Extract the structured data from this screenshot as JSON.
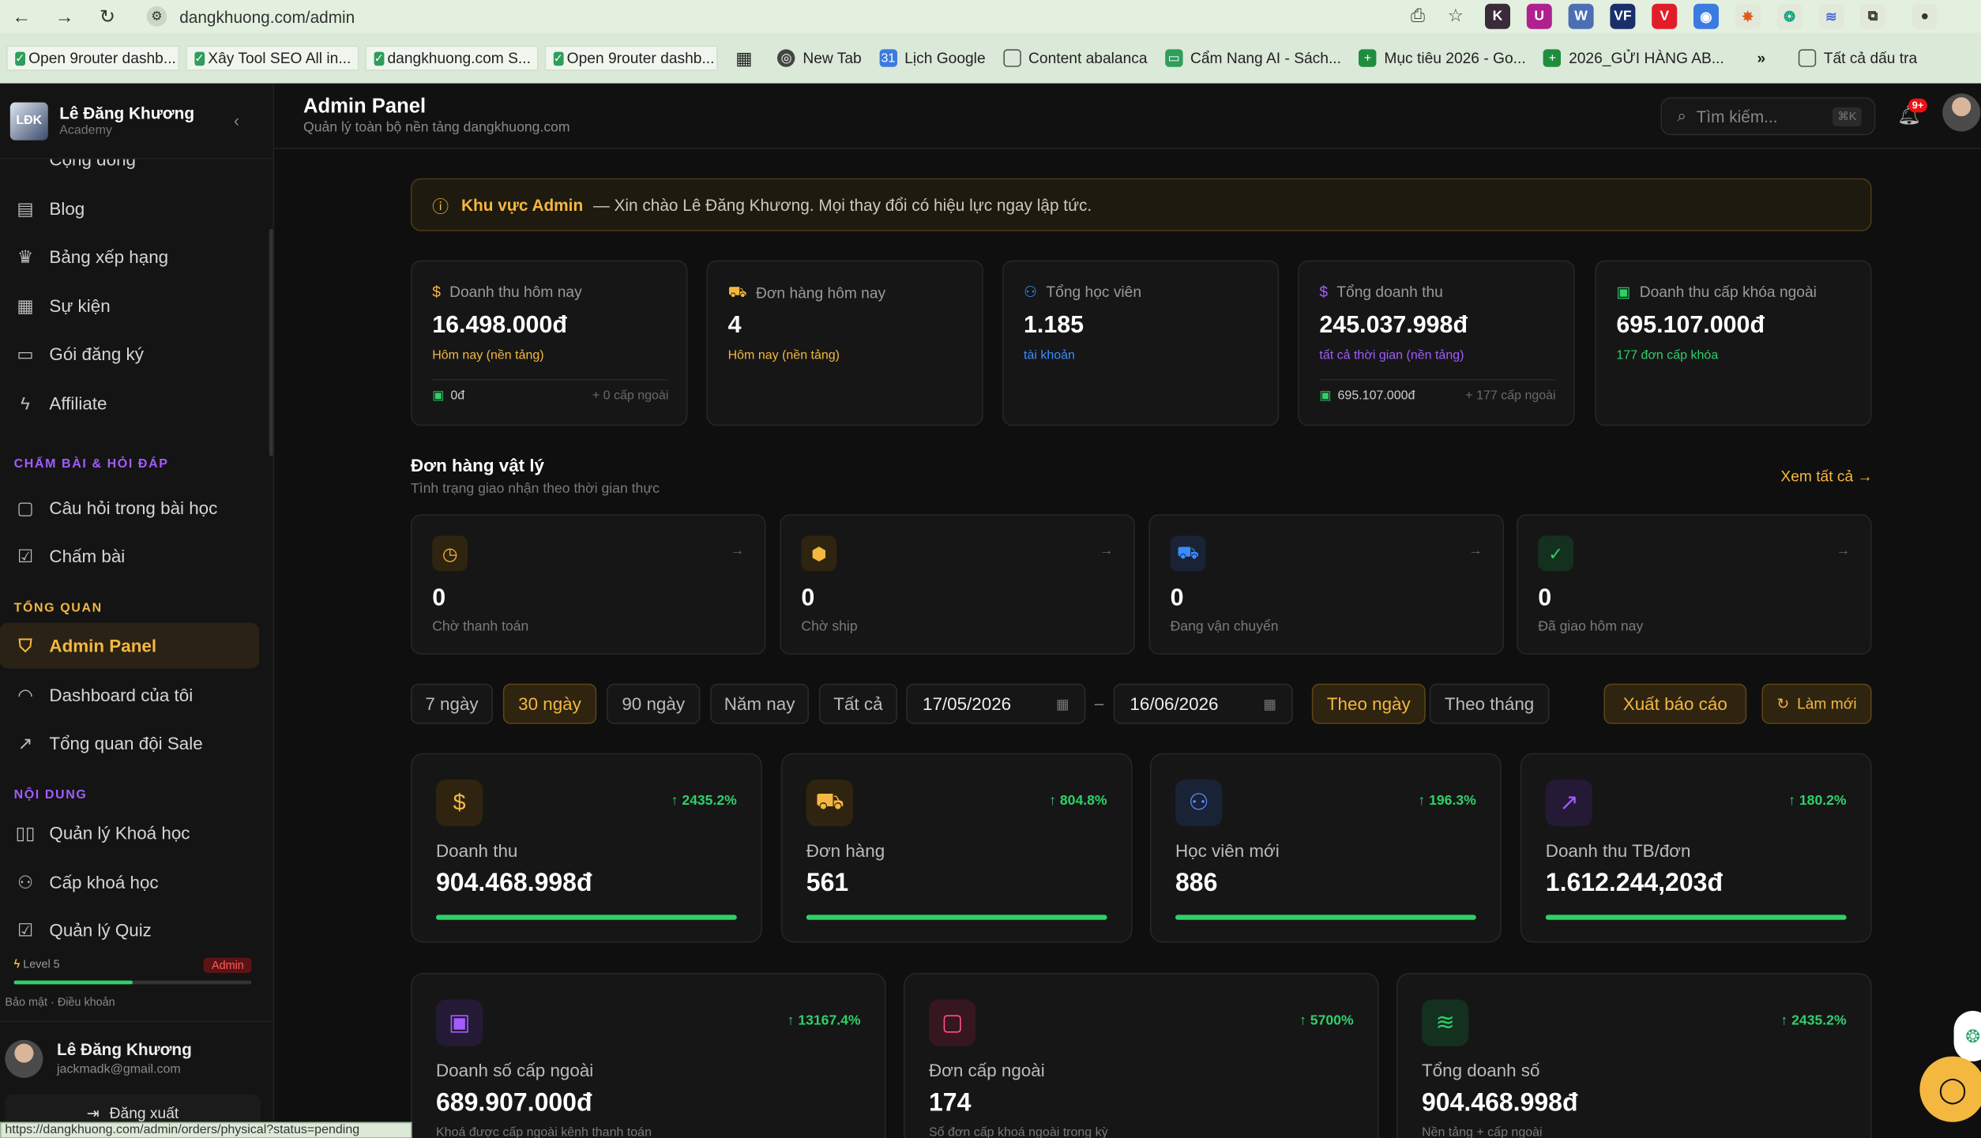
{
  "browser": {
    "url": "dangkhuong.com/admin",
    "status_url": "https://dangkhuong.com/admin/orders/physical?status=pending",
    "tabs": [
      "Open 9router dashb...",
      "Xây Tool SEO All in...",
      "dangkhuong.com S...",
      "Open 9router dashb..."
    ],
    "bookmarks": [
      "New Tab",
      "Lịch Google",
      "Content abalanca",
      "Cẩm Nang AI - Sách...",
      "Mục tiêu 2026 - Go...",
      "2026_GỬI HÀNG AB..."
    ],
    "all_bookmarks": "Tất cả dấu tra"
  },
  "sidebar": {
    "brand_name": "Lê Đăng Khương",
    "brand_sub": "Academy",
    "items": [
      {
        "label": "Cộng đồng",
        "icon": "community-icon"
      },
      {
        "label": "Blog",
        "icon": "blog-icon"
      },
      {
        "label": "Bảng xếp hạng",
        "icon": "trophy-icon"
      },
      {
        "label": "Sự kiện",
        "icon": "calendar-icon"
      },
      {
        "label": "Gói đăng ký",
        "icon": "card-icon"
      },
      {
        "label": "Affiliate",
        "icon": "bolt-icon"
      }
    ],
    "section_grading": "CHẤM BÀI & HỎI ĐÁP",
    "grading_items": [
      {
        "label": "Câu hỏi trong bài học",
        "icon": "chat-bubble-icon"
      },
      {
        "label": "Chấm bài",
        "icon": "clipboard-check-icon"
      }
    ],
    "section_overview": "TỔNG QUAN",
    "overview_items": [
      {
        "label": "Admin Panel",
        "icon": "shield-check-icon",
        "active": true
      },
      {
        "label": "Dashboard của tôi",
        "icon": "gauge-icon"
      },
      {
        "label": "Tổng quan đội Sale",
        "icon": "trend-icon"
      }
    ],
    "section_content": "NỘI DUNG",
    "content_items": [
      {
        "label": "Quản lý Khoá học",
        "icon": "book-icon"
      },
      {
        "label": "Cấp khoá học",
        "icon": "user-plus-icon"
      },
      {
        "label": "Quản lý Quiz",
        "icon": "clipboard-icon"
      }
    ],
    "level": "Level 5",
    "level_progress": 0.5,
    "role_badge": "Admin",
    "footer_links": "Bảo mật  ·  Điều khoản",
    "user_name": "Lê Đăng Khương",
    "user_email": "jackmadk@gmail.com",
    "logout": "Đăng xuất"
  },
  "header": {
    "title": "Admin Panel",
    "subtitle": "Quản lý toàn bộ nền tảng dangkhuong.com",
    "search_placeholder": "Tìm kiếm...",
    "search_shortcut": "⌘K",
    "notif_count": "9+"
  },
  "banner": {
    "title": "Khu vực Admin",
    "text": "— Xin chào Lê Đăng Khương. Mọi thay đổi có hiệu lực ngay lập tức."
  },
  "kpis": [
    {
      "label": "Doanh thu hôm nay",
      "value": "16.498.000đ",
      "sub": "Hôm nay (nền tảng)",
      "sub_color": "#f4b740",
      "foot_left": "0đ",
      "foot_right": "+ 0 cấp ngoài",
      "icon": "dollar-icon",
      "icon_color": "#f4b740"
    },
    {
      "label": "Đơn hàng hôm nay",
      "value": "4",
      "sub": "Hôm nay (nền tảng)",
      "sub_color": "#f4b740",
      "icon": "cart-icon",
      "icon_color": "#f4b740"
    },
    {
      "label": "Tổng học viên",
      "value": "1.185",
      "sub": "tài khoản",
      "sub_color": "#3b8cff",
      "icon": "users-icon",
      "icon_color": "#3b8cff"
    },
    {
      "label": "Tổng doanh thu",
      "value": "245.037.998đ",
      "sub": "tất cả thời gian (nền tảng)",
      "sub_color": "#a25cff",
      "foot_left": "695.107.000đ",
      "foot_right": "+ 177 cấp ngoài",
      "icon": "dollar-icon",
      "icon_color": "#a25cff"
    },
    {
      "label": "Doanh thu cấp khóa ngoài",
      "value": "695.107.000đ",
      "sub": "177 đơn cấp khóa",
      "sub_color": "#2fd06a",
      "icon": "gift-icon",
      "icon_color": "#2fd06a"
    }
  ],
  "physical": {
    "title": "Đơn hàng vật lý",
    "subtitle": "Tình trạng giao nhận theo thời gian thực",
    "see_all": "Xem tất cả →",
    "cards": [
      {
        "value": "0",
        "label": "Chờ thanh toán",
        "icon": "clock-icon",
        "color": "#f4b740"
      },
      {
        "value": "0",
        "label": "Chờ ship",
        "icon": "package-icon",
        "color": "#f4b740"
      },
      {
        "value": "0",
        "label": "Đang vận chuyển",
        "icon": "truck-icon",
        "color": "#3b8cff"
      },
      {
        "value": "0",
        "label": "Đã giao hôm nay",
        "icon": "check-circle-icon",
        "color": "#2fd06a"
      }
    ]
  },
  "filters": {
    "ranges": [
      "7 ngày",
      "30 ngày",
      "90 ngày",
      "Năm nay",
      "Tất cả"
    ],
    "active_range": "30 ngày",
    "date_from": "17/05/2026",
    "date_to": "16/06/2026",
    "group_by": [
      "Theo ngày",
      "Theo tháng"
    ],
    "active_group": "Theo ngày",
    "export": "Xuất báo cáo",
    "refresh": "Làm mới"
  },
  "metrics": [
    {
      "label": "Doanh thu",
      "value": "904.468.998đ",
      "change": "↑ 2435.2%",
      "icon": "dollar-icon",
      "color": "#f4b740",
      "bg": "#2e2410"
    },
    {
      "label": "Đơn hàng",
      "value": "561",
      "change": "↑ 804.8%",
      "icon": "cart-icon",
      "color": "#f4b740",
      "bg": "#2e2410"
    },
    {
      "label": "Học viên mới",
      "value": "886",
      "change": "↑ 196.3%",
      "icon": "users-icon",
      "color": "#5b8cff",
      "bg": "#1a2236"
    },
    {
      "label": "Doanh thu TB/đơn",
      "value": "1.612.244,203đ",
      "change": "↑ 180.2%",
      "icon": "trend-up-icon",
      "color": "#a25cff",
      "bg": "#241a36"
    }
  ],
  "external": [
    {
      "label": "Doanh số cấp ngoài",
      "value": "689.907.000đ",
      "change": "↑ 13167.4%",
      "sub": "Khoá được cấp ngoài kênh thanh toán",
      "icon": "gift-icon",
      "color": "#a25cff",
      "bg": "#241a36"
    },
    {
      "label": "Đơn cấp ngoài",
      "value": "174",
      "change": "↑ 5700%",
      "sub": "Số đơn cấp khoá ngoài trong kỳ",
      "icon": "bag-icon",
      "color": "#ff4f8b",
      "bg": "#36161f"
    },
    {
      "label": "Tổng doanh số",
      "value": "904.468.998đ",
      "change": "↑ 2435.2%",
      "sub": "Nền tảng + cấp ngoài",
      "icon": "layers-icon",
      "color": "#2fd06a",
      "bg": "#14301f"
    }
  ]
}
